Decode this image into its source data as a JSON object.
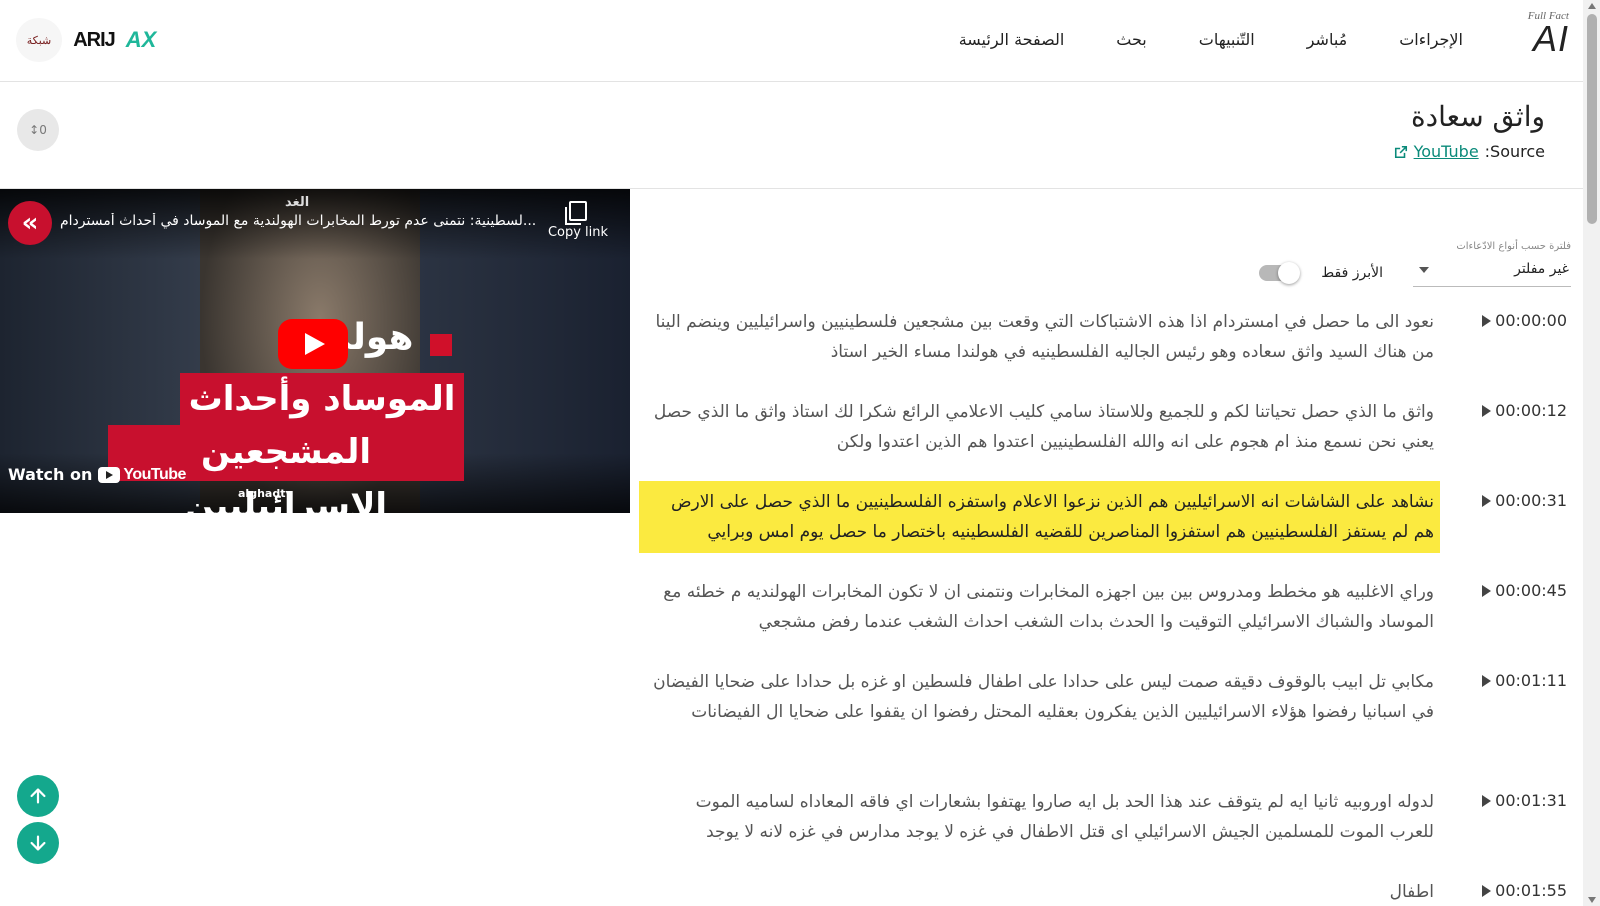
{
  "brand": {
    "sub": "Full Fact",
    "main": "AI"
  },
  "nav": [
    {
      "label": "الصفحة الرئيسة"
    },
    {
      "label": "بحث"
    },
    {
      "label": "التّنبيهات"
    },
    {
      "label": "مُباشر"
    },
    {
      "label": "الإجراءات"
    }
  ],
  "partners": {
    "p1": "شبكة",
    "p2": "ARIJ",
    "p3": "AX"
  },
  "page": {
    "title": "واثق سعادة",
    "source_label": "Source:",
    "source_link": "YouTube",
    "counter": "↕0"
  },
  "video": {
    "title": "...لسطينية: نتمنى عدم تورط المخابرات الهولندية مع الموساد في أحداث أمستردام",
    "copy_label": "Copy link",
    "overlay_brand": "هولن",
    "caption_1": "الموساد وأحداث",
    "caption_2": "المشجعين الإسرائيليين",
    "watch_label": "Watch on",
    "watch_brand": "YouTube",
    "handle": "alghadtv",
    "channel_tag": "الغد"
  },
  "filter": {
    "label": "فلترة حسب أنواع الادّعاءات",
    "selected": "غير مفلتر",
    "toggle_label": "الأبرز فقط"
  },
  "segments": [
    {
      "time": "00:00:00",
      "text": "نعود الى ما حصل في امستردام اذا هذه الاشتباكات التي وقعت بين مشجعين فلسطينيين واسرائيليين وينضم الينا من هناك السيد واثق سعاده وهو رئيس الجاليه الفلسطينيه في هولندا مساء الخير استاذ",
      "highlight": false
    },
    {
      "time": "00:00:12",
      "text": "واثق ما الذي حصل تحياتنا لكم و للجميع وللاستاذ سامي كليب الاعلامي الرائع شكرا لك استاذ واثق ما الذي حصل يعني نحن نسمع منذ ام هجوم على انه والله الفلسطينيين اعتدوا هم الذين اعتدوا ولكن",
      "highlight": false
    },
    {
      "time": "00:00:31",
      "text": "نشاهد على الشاشات انه الاسرائيليين هم الذين نزعوا الاعلام واستفزه الفلسطينيين ما الذي حصل على الارض هم لم يستفز الفلسطينيين هم استفزوا المناصرين للقضيه الفلسطينيه باختصار ما حصل يوم امس وبرايي",
      "highlight": true
    },
    {
      "time": "00:00:45",
      "text": "وراي الاغلبيه هو مخطط ومدروس بين بين اجهزه المخابرات ونتمنى ان لا تكون المخابرات الهولنديه م خطئه مع الموساد والشباك الاسرائيلي التوقيت وا الحدث بدات الشغب احداث الشغب عندما رفض مشجعي",
      "highlight": false
    },
    {
      "time": "00:01:11",
      "text": "مكابي تل ابيب بالوقوف دقيقه صمت ليس على حدادا على اطفال فلسطين او غزه بل حدادا على ضحايا الفيضان في اسبانيا رفضوا هؤلاء الاسرائيليين الذين يفكرون بعقليه المحتل رفضوا ان يقفوا على ضحايا ال الفيضانات",
      "highlight": false
    },
    {
      "time": "00:01:31",
      "text": "لدوله اوروبيه ثانيا ايه لم يتوقف عند هذا الحد بل ايه صاروا يهتفوا بشعارات اي فاقه المعاداه لساميه الموت للعرب الموت للمسلمين الجيش الاسرائيلي اى قتل الاطفال في غزه لا يوجد مدارس في غزه لانه لا يوجد",
      "highlight": false
    },
    {
      "time": "00:01:55",
      "text": "اطفال",
      "highlight": false
    }
  ]
}
